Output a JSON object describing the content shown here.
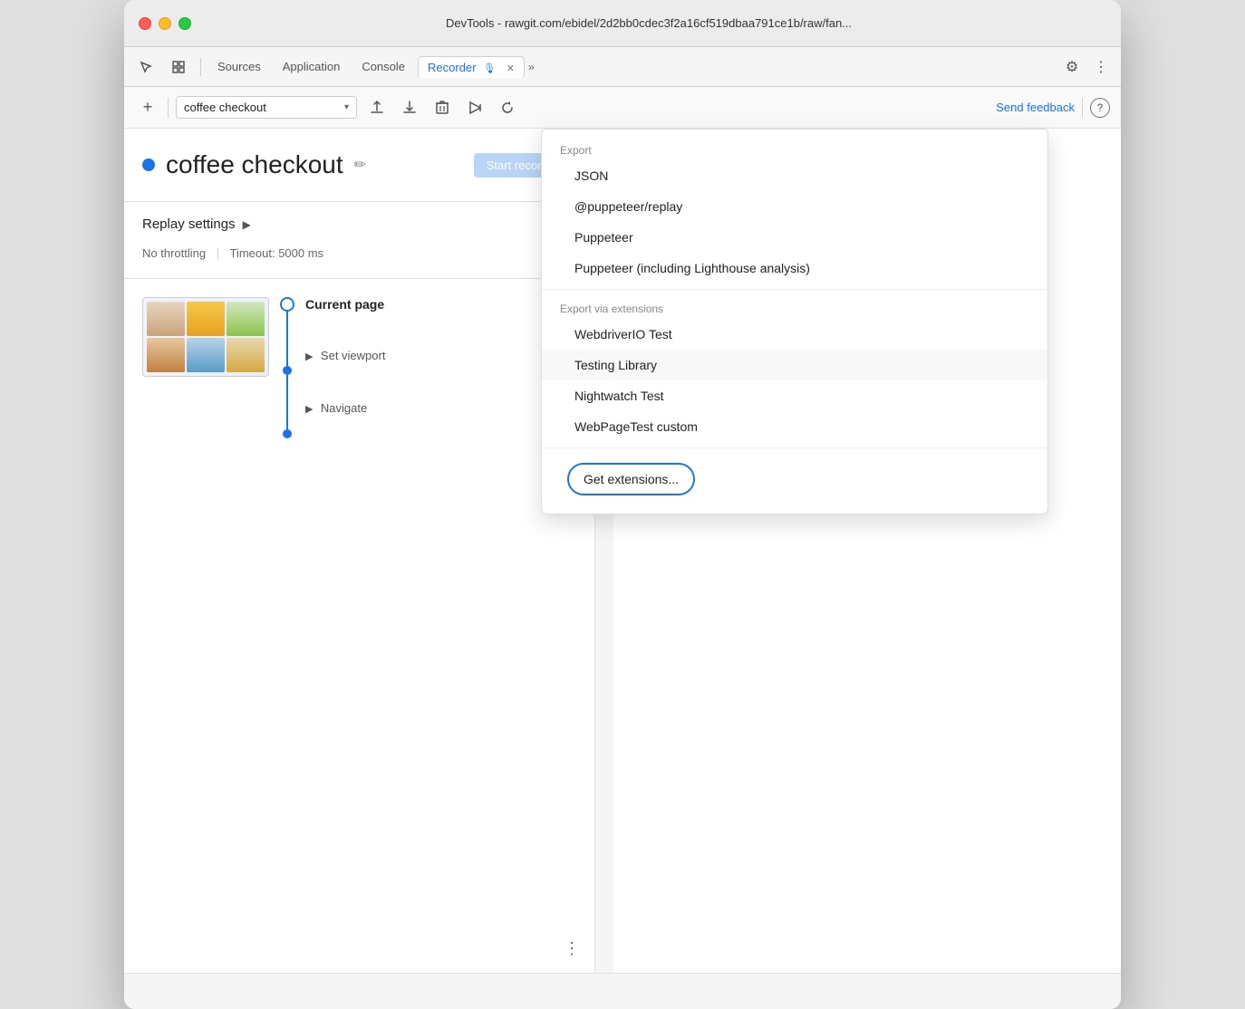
{
  "window": {
    "title": "DevTools - rawgit.com/ebidel/2d2bb0cdec3f2a16cf519dbaa791ce1b/raw/fan...",
    "traffic_lights": [
      "red",
      "yellow",
      "green"
    ]
  },
  "tabs": {
    "items": [
      {
        "id": "sources",
        "label": "Sources",
        "active": false
      },
      {
        "id": "application",
        "label": "Application",
        "active": false
      },
      {
        "id": "console",
        "label": "Console",
        "active": false
      },
      {
        "id": "recorder",
        "label": "Recorder",
        "active": true
      }
    ],
    "more_label": "»",
    "gear_icon": "⚙",
    "dots_icon": "⋮"
  },
  "toolbar": {
    "add_icon": "+",
    "recording_name": "coffee checkout",
    "chevron": "▾",
    "upload_icon": "↑",
    "download_icon": "↓",
    "delete_icon": "🗑",
    "play_icon": "▶",
    "replay_icon": "↺",
    "send_feedback": "Send feedback",
    "help_icon": "?"
  },
  "recording": {
    "title": "coffee checkout",
    "edit_icon": "✏",
    "dot_color": "#1a73e8"
  },
  "replay_settings": {
    "label": "Replay settings",
    "arrow": "▶",
    "no_throttling": "No throttling",
    "timeout": "Timeout: 5000 ms"
  },
  "steps": {
    "current_page_label": "Current p",
    "set_viewport_label": "Set viewpo",
    "navigate_label": "Navigate"
  },
  "export_menu": {
    "export_section": "Export",
    "items": [
      {
        "id": "json",
        "label": "JSON"
      },
      {
        "id": "puppeteer-replay",
        "label": "@puppeteer/replay"
      },
      {
        "id": "puppeteer",
        "label": "Puppeteer"
      },
      {
        "id": "puppeteer-lighthouse",
        "label": "Puppeteer (including Lighthouse analysis)"
      }
    ],
    "extensions_section": "Export via extensions",
    "extension_items": [
      {
        "id": "webdriverio",
        "label": "WebdriverIO Test"
      },
      {
        "id": "testing-library",
        "label": "Testing Library"
      },
      {
        "id": "nightwatch",
        "label": "Nightwatch Test"
      },
      {
        "id": "webpagetest",
        "label": "WebPageTest custom"
      }
    ],
    "get_extensions_label": "Get extensions..."
  }
}
